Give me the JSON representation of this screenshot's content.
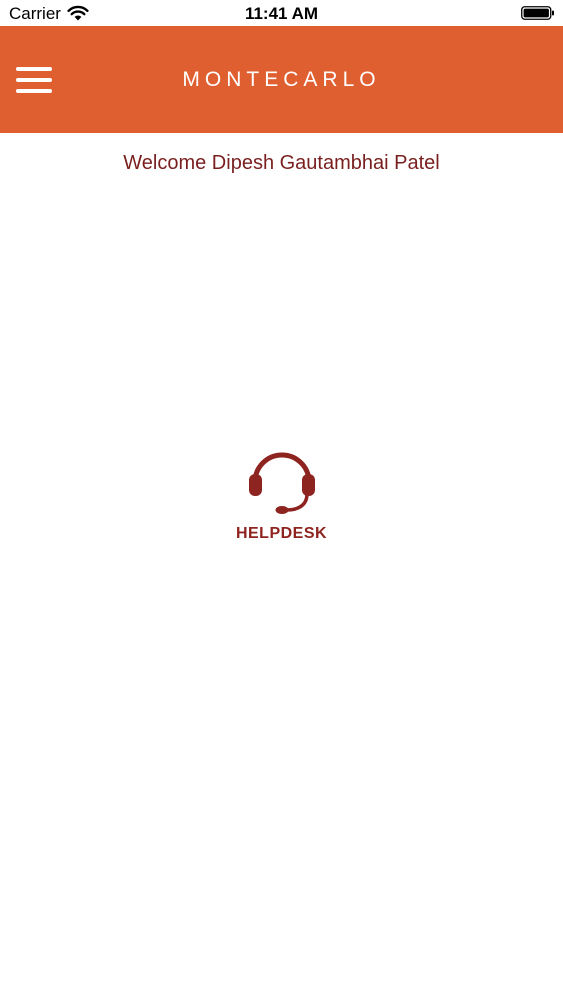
{
  "status_bar": {
    "carrier": "Carrier",
    "time": "11:41 AM",
    "wifi_icon": "wifi-icon",
    "battery_icon": "battery-icon"
  },
  "header": {
    "title": "MONTECARLO",
    "menu_icon": "hamburger-menu-icon"
  },
  "main": {
    "welcome_text": "Welcome Dipesh Gautambhai Patel",
    "helpdesk": {
      "label": "HELPDESK",
      "icon": "headset-icon"
    }
  },
  "colors": {
    "header_bg": "#e05f30",
    "header_text": "#ffffff",
    "welcome_text": "#7a1f1f",
    "accent": "#8e2420",
    "background": "#ffffff"
  }
}
